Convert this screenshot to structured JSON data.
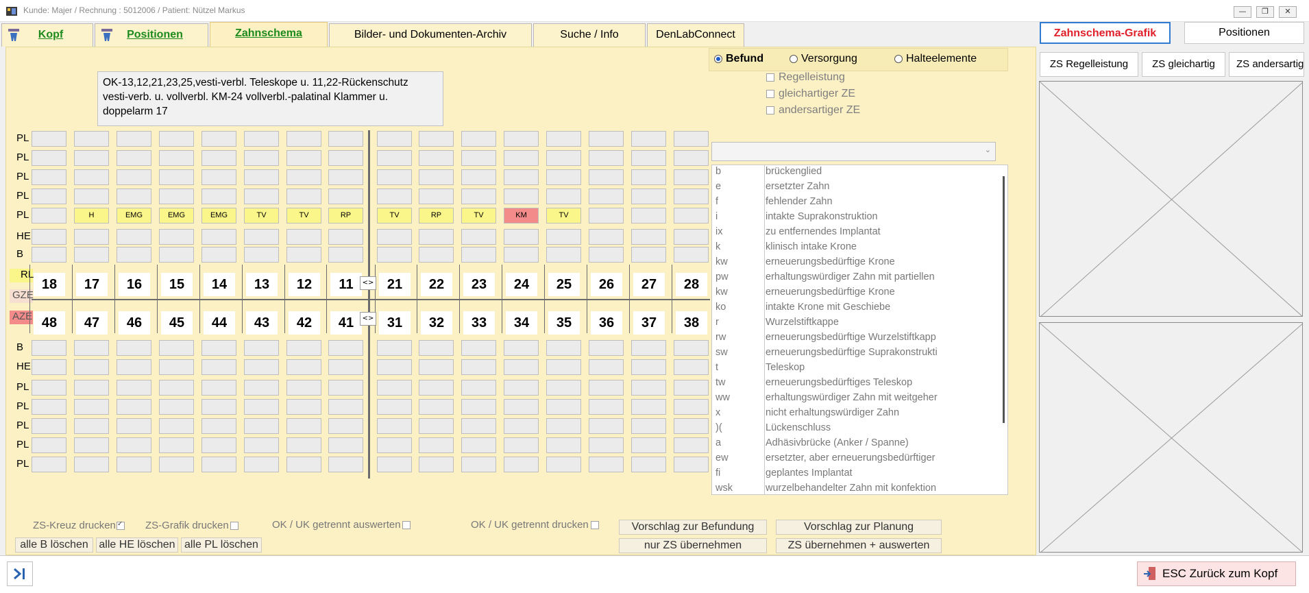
{
  "window": {
    "title": "Kunde: Majer  / Rechnung : 5012006 / Patient: Nützel Markus"
  },
  "tabs": {
    "kopf": "Kopf",
    "positionen": "Positionen",
    "zahnschema": "Zahnschema",
    "archiv": "Bilder- und Dokumenten-Archiv",
    "suche": "Suche / Info",
    "denlab": "DenLabConnect"
  },
  "right_header": {
    "grafik": "Zahnschema-Grafik",
    "positionen": "Positionen",
    "zs_regel": "ZS Regelleistung",
    "zs_gleich": "ZS gleichartig",
    "zs_anders": "ZS andersartig"
  },
  "note": "OK-13,12,21,23,25,vesti-verbl. Teleskope u. 11,22-Rückenschutz\nvesti-verb. u. vollverbl. KM-24 vollverbl.-palatinal Klammer u.\ndoppelarm 17",
  "radios": {
    "befund": "Befund",
    "versorgung": "Versorgung",
    "halteelemente": "Halteelemente",
    "selected": "befund"
  },
  "checks": {
    "regel": "Regelleistung",
    "gleich": "gleichartiger ZE",
    "anders": "andersartiger ZE"
  },
  "row_labels": {
    "upper": [
      "PL",
      "PL",
      "PL",
      "PL",
      "PL",
      "HE",
      "B"
    ],
    "rl": "RL",
    "gze": "GZE",
    "aze": "AZE",
    "lower": [
      "B",
      "HE",
      "PL",
      "PL",
      "PL",
      "PL",
      "PL"
    ]
  },
  "teeth_upper": [
    "18",
    "17",
    "16",
    "15",
    "14",
    "13",
    "12",
    "11",
    "21",
    "22",
    "23",
    "24",
    "25",
    "26",
    "27",
    "28"
  ],
  "teeth_lower": [
    "48",
    "47",
    "46",
    "45",
    "44",
    "43",
    "42",
    "41",
    "31",
    "32",
    "33",
    "34",
    "35",
    "36",
    "37",
    "38"
  ],
  "pl_row": [
    "",
    "H",
    "EMG",
    "EMG",
    "EMG",
    "TV",
    "TV",
    "RP",
    "TV",
    "RP",
    "TV",
    "KM",
    "TV",
    "",
    "",
    ""
  ],
  "pl_row_colors": [
    "none",
    "yellow",
    "yellow",
    "yellow",
    "yellow",
    "yellow",
    "yellow",
    "yellow",
    "yellow",
    "yellow",
    "yellow",
    "red",
    "yellow",
    "none",
    "none",
    "none"
  ],
  "mid_btn": "<>",
  "legend": [
    {
      "k": "b",
      "v": "brückenglied"
    },
    {
      "k": "e",
      "v": "ersetzter Zahn"
    },
    {
      "k": "f",
      "v": "fehlender Zahn"
    },
    {
      "k": "i",
      "v": "intakte Suprakonstruktion"
    },
    {
      "k": "ix",
      "v": "zu entfernendes Implantat"
    },
    {
      "k": "k",
      "v": "klinisch intake Krone"
    },
    {
      "k": "kw",
      "v": "erneuerungsbedürftige Krone"
    },
    {
      "k": "pw",
      "v": "erhaltungswürdiger Zahn mit partiellen"
    },
    {
      "k": "kw",
      "v": "erneuerungsbedürftige Krone"
    },
    {
      "k": "ko",
      "v": "intakte Krone mit Geschiebe"
    },
    {
      "k": "r",
      "v": "Wurzelstiftkappe"
    },
    {
      "k": "rw",
      "v": "erneuerungsbedürftige Wurzelstiftkapp"
    },
    {
      "k": "sw",
      "v": "erneuerungsbedürftige Suprakonstrukti"
    },
    {
      "k": "t",
      "v": "Teleskop"
    },
    {
      "k": "tw",
      "v": "erneuerungsbedürftiges Teleskop"
    },
    {
      "k": "ww",
      "v": "erhaltungswürdiger Zahn mit weitgeher"
    },
    {
      "k": "x",
      "v": "nicht erhaltungswürdiger Zahn"
    },
    {
      "k": ")(",
      "v": "Lückenschluss"
    },
    {
      "k": "a",
      "v": "Adhäsivbrücke (Anker / Spanne)"
    },
    {
      "k": "ew",
      "v": "ersetzter, aber erneuerungsbedürftiger"
    },
    {
      "k": "fi",
      "v": "geplantes Implantat"
    },
    {
      "k": "wsk",
      "v": "wurzelbehandelter Zahn mit konfektion"
    }
  ],
  "bottom": {
    "zs_kreuz": "ZS-Kreuz drucken",
    "zs_grafik": "ZS-Grafik drucken",
    "okuk_auswerten": "OK / UK getrennt auswerten",
    "okuk_drucken": "OK / UK getrennt drucken",
    "alle_b": "alle B löschen",
    "alle_he": "alle HE löschen",
    "alle_pl": "alle PL löschen",
    "vorschlag_befund": "Vorschlag zur Befundung",
    "vorschlag_planung": "Vorschlag zur Planung",
    "nur_zs": "nur ZS übernehmen",
    "zs_auswerten": "ZS übernehmen + auswerten"
  },
  "footer": {
    "esc": "ESC Zurück zum Kopf"
  },
  "colors": {
    "panel": "#fcf1c5",
    "yellow_cell": "#fbf68a",
    "red_cell": "#f28b89",
    "grafik_text": "#e0202a"
  }
}
